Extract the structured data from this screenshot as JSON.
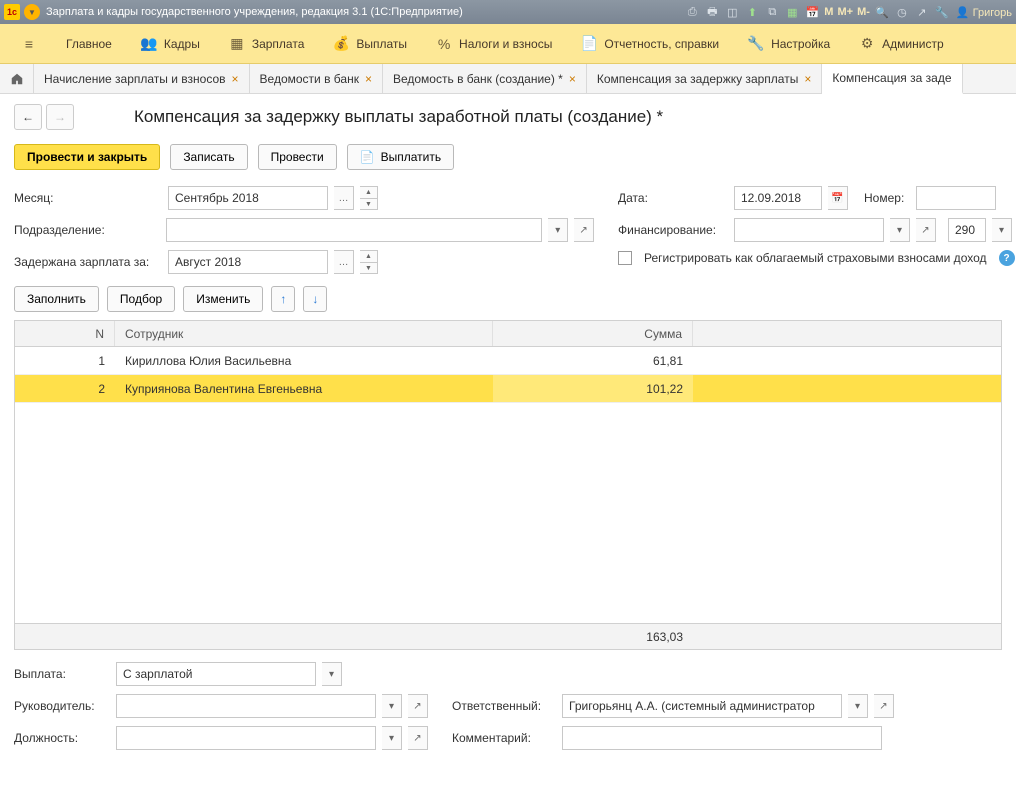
{
  "titlebar": {
    "app_title": "Зарплата и кадры государственного учреждения, редакция 3.1  (1С:Предприятие)",
    "m": "M",
    "mplus": "M+",
    "mminus": "M-",
    "user": "Григорь"
  },
  "menu": {
    "main": "Главное",
    "personnel": "Кадры",
    "salary": "Зарплата",
    "payments": "Выплаты",
    "taxes": "Налоги и взносы",
    "reports": "Отчетность, справки",
    "settings": "Настройка",
    "admin": "Администр"
  },
  "tabs": {
    "t1": "Начисление зарплаты и взносов",
    "t2": "Ведомости в банк",
    "t3": "Ведомость в банк (создание) *",
    "t4": "Компенсация за задержку зарплаты",
    "t5": "Компенсация за заде"
  },
  "page": {
    "title": "Компенсация за задержку выплаты заработной платы (создание) *"
  },
  "buttons": {
    "post_close": "Провести и закрыть",
    "save": "Записать",
    "post": "Провести",
    "pay": "Выплатить",
    "fill": "Заполнить",
    "pick": "Подбор",
    "edit": "Изменить"
  },
  "labels": {
    "month": "Месяц:",
    "department": "Подразделение:",
    "withheld_for": "Задержана зарплата за:",
    "date": "Дата:",
    "number": "Номер:",
    "financing": "Финансирование:",
    "register_tax": "Регистрировать как облагаемый страховыми взносами доход",
    "payment": "Выплата:",
    "manager": "Руководитель:",
    "position": "Должность:",
    "responsible": "Ответственный:",
    "comment": "Комментарий:"
  },
  "fields": {
    "month": "Сентябрь 2018",
    "withheld_for": "Август 2018",
    "date": "12.09.2018",
    "number": "",
    "department": "",
    "fin_code": "290",
    "payment": "С зарплатой",
    "manager": "",
    "position": "",
    "responsible": "Григорьянц А.А. (системный администратор",
    "comment": ""
  },
  "table": {
    "col_n": "N",
    "col_emp": "Сотрудник",
    "col_sum": "Сумма",
    "rows": [
      {
        "n": "1",
        "emp": "Кириллова Юлия Васильевна",
        "sum": "61,81"
      },
      {
        "n": "2",
        "emp": "Куприянова Валентина Евгеньевна",
        "sum": "101,22"
      }
    ],
    "total": "163,03"
  }
}
